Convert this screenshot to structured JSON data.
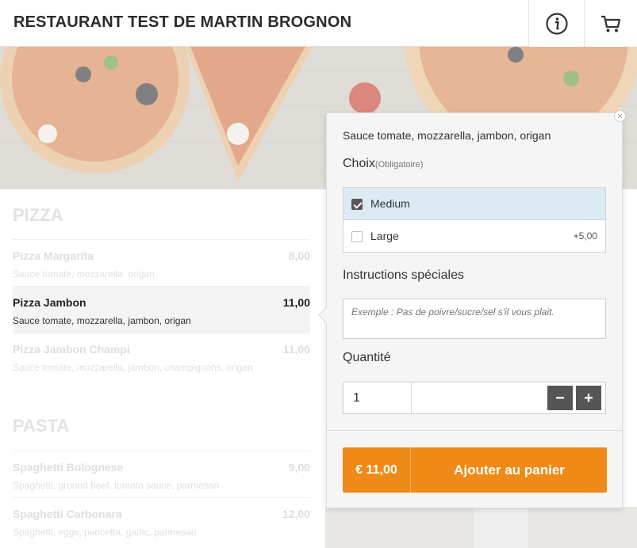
{
  "header": {
    "title": "RESTAURANT TEST DE MARTIN BROGNON",
    "icons": [
      "menu-book-icon",
      "info-icon",
      "cart-icon"
    ]
  },
  "colors": {
    "accent": "#ef8a17",
    "selected_option": "#dceaf4",
    "stepper": "#555555"
  },
  "menu": {
    "categories": [
      {
        "title": "PIZZA",
        "items": [
          {
            "name": "Pizza Margarita",
            "price": "8,00",
            "desc": "Sauce tomate, mozzarella, origan"
          },
          {
            "name": "Pizza Jambon",
            "price": "11,00",
            "desc": "Sauce tomate, mozzarella, jambon, origan",
            "selected": true
          },
          {
            "name": "Pizza Jambon Champi",
            "price": "11,00",
            "desc": "Sauce tomate, mozzarella, jambon, champignons, origan"
          }
        ]
      },
      {
        "title": "PASTA",
        "items": [
          {
            "name": "Spaghetti Bolognese",
            "price": "9,00",
            "desc": "Spaghetti, ground beef, tomato sauce, parmesan"
          },
          {
            "name": "Spaghetti Carbonara",
            "price": "12,00",
            "desc": "Spaghetti, eggs, pancetta, garlic, parmesan"
          }
        ]
      }
    ]
  },
  "popup": {
    "description": "Sauce tomate, mozzarella, jambon, origan",
    "choice_label": "Choix",
    "choice_required": "(Obligatoire)",
    "options": [
      {
        "label": "Medium",
        "extra": "",
        "checked": true
      },
      {
        "label": "Large",
        "extra": "+5,00",
        "checked": false
      }
    ],
    "instructions_label": "Instructions spéciales",
    "instructions_placeholder": "Exemple : Pas de poivre/sucre/sel s'il vous plait.",
    "quantity_label": "Quantité",
    "quantity_value": "1",
    "minus": "−",
    "plus": "+",
    "total_price": "€ 11,00",
    "add_label": "Ajouter au panier"
  }
}
